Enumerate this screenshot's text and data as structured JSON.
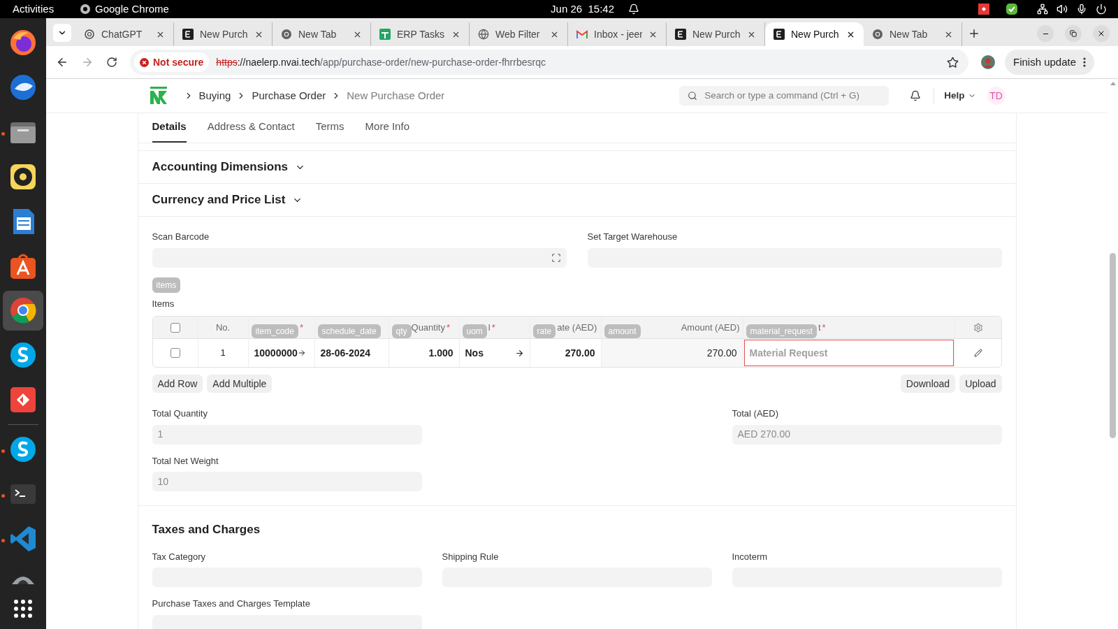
{
  "system_bar": {
    "activities": "Activities",
    "app_name": "Google Chrome",
    "clock": "Jun 26  15:42"
  },
  "dock": [
    {
      "kind": "firefox",
      "running": false,
      "selected": false
    },
    {
      "kind": "mail",
      "running": false,
      "selected": false
    },
    {
      "kind": "files",
      "running": true,
      "selected": false
    },
    {
      "kind": "music",
      "running": false,
      "selected": false
    },
    {
      "kind": "writer",
      "running": false,
      "selected": false
    },
    {
      "kind": "store",
      "running": false,
      "selected": false
    },
    {
      "kind": "chrome",
      "running": false,
      "selected": true
    },
    {
      "kind": "chat",
      "running": false,
      "selected": false
    },
    {
      "kind": "remote",
      "running": false,
      "selected": false
    },
    {
      "kind": "chat",
      "running": true,
      "selected": false
    },
    {
      "kind": "terminal",
      "running": true,
      "selected": false
    },
    {
      "kind": "code",
      "running": true,
      "selected": false
    },
    {
      "kind": "partial",
      "running": false,
      "selected": false
    },
    {
      "kind": "grid",
      "running": false,
      "selected": false
    }
  ],
  "browser": {
    "tabs": [
      {
        "title": "ChatGPT",
        "kind": "openai",
        "selected": false
      },
      {
        "title": "New Purch",
        "kind": "erp",
        "selected": false
      },
      {
        "title": "New Tab",
        "kind": "chrome",
        "selected": false
      },
      {
        "title": "ERP Tasks",
        "kind": "sheets",
        "selected": false
      },
      {
        "title": "Web Filter",
        "kind": "globe",
        "selected": false
      },
      {
        "title": "Inbox - jeer",
        "kind": "gmail",
        "selected": false
      },
      {
        "title": "New Purch",
        "kind": "erp",
        "selected": false
      },
      {
        "title": "New Purch",
        "kind": "erp",
        "selected": true
      },
      {
        "title": "New Tab",
        "kind": "chrome",
        "selected": false
      }
    ],
    "security": "Not secure",
    "url_scheme": "https",
    "url_sep": "://",
    "url_host": "naelerp.nvai.tech",
    "url_path": "/app/purchase-order/new-purchase-order-fhrrbesrqc",
    "update_button": "Finish update"
  },
  "navbar": {
    "breadcrumbs": [
      {
        "label": "Buying",
        "current": false
      },
      {
        "label": "Purchase Order",
        "current": false
      },
      {
        "label": "New Purchase Order",
        "current": true
      }
    ],
    "search_placeholder": "Search or type a command (Ctrl + G)",
    "help": "Help",
    "avatar": "TD"
  },
  "form_tabs": [
    {
      "label": "Details",
      "selected": true
    },
    {
      "label": "Address & Contact",
      "selected": false
    },
    {
      "label": "Terms",
      "selected": false
    },
    {
      "label": "More Info",
      "selected": false
    }
  ],
  "collapsed_sections": [
    {
      "title": "Accounting Dimensions",
      "expanded": false
    },
    {
      "title": "Currency and Price List",
      "expanded": false
    }
  ],
  "scan_barcode": {
    "label": "Scan Barcode"
  },
  "target_warehouse": {
    "label": "Set Target Warehouse"
  },
  "items_badge": "items",
  "items_label": "Items",
  "table": {
    "columns": [
      {
        "kind": "check",
        "checked": false
      },
      {
        "kind": "text",
        "label": "No."
      },
      {
        "kind": "field",
        "badge": "item_code",
        "required_mark": "*"
      },
      {
        "kind": "field",
        "badge": "schedule_date"
      },
      {
        "kind": "field",
        "badge": "qty",
        "label": "Quantity",
        "required_mark": "*"
      },
      {
        "kind": "field",
        "badge": "uom",
        "label": "l",
        "required_mark": "*"
      },
      {
        "kind": "field",
        "badge": "rate",
        "label": "ate (AED)"
      },
      {
        "kind": "field",
        "badge": "amount",
        "label": "Amount (AED)"
      },
      {
        "kind": "field",
        "badge": "material_request",
        "label": "t",
        "required_mark": "*"
      },
      {
        "kind": "settings"
      }
    ],
    "rows": [
      {
        "checked": false,
        "no": "1",
        "item_code": "10000000",
        "schedule_date": "28-06-2024",
        "qty": "1.000",
        "uom": "Nos",
        "rate": "270.00",
        "amount": "270.00",
        "material_request_placeholder": "Material Request",
        "invalid": true
      }
    ]
  },
  "table_buttons": {
    "left": [
      "Add Row",
      "Add Multiple"
    ],
    "right": [
      "Download",
      "Upload"
    ]
  },
  "totals": [
    {
      "label": "Total Quantity",
      "value": "1"
    },
    {
      "label": "Total (AED)",
      "value": "AED 270.00"
    },
    {
      "label": "Total Net Weight",
      "value": "10"
    }
  ],
  "taxes": {
    "title": "Taxes and Charges",
    "fields": [
      {
        "label": "Tax Category"
      },
      {
        "label": "Shipping Rule"
      },
      {
        "label": "Incoterm"
      }
    ],
    "template_label": "Purchase Taxes and Charges Template"
  }
}
